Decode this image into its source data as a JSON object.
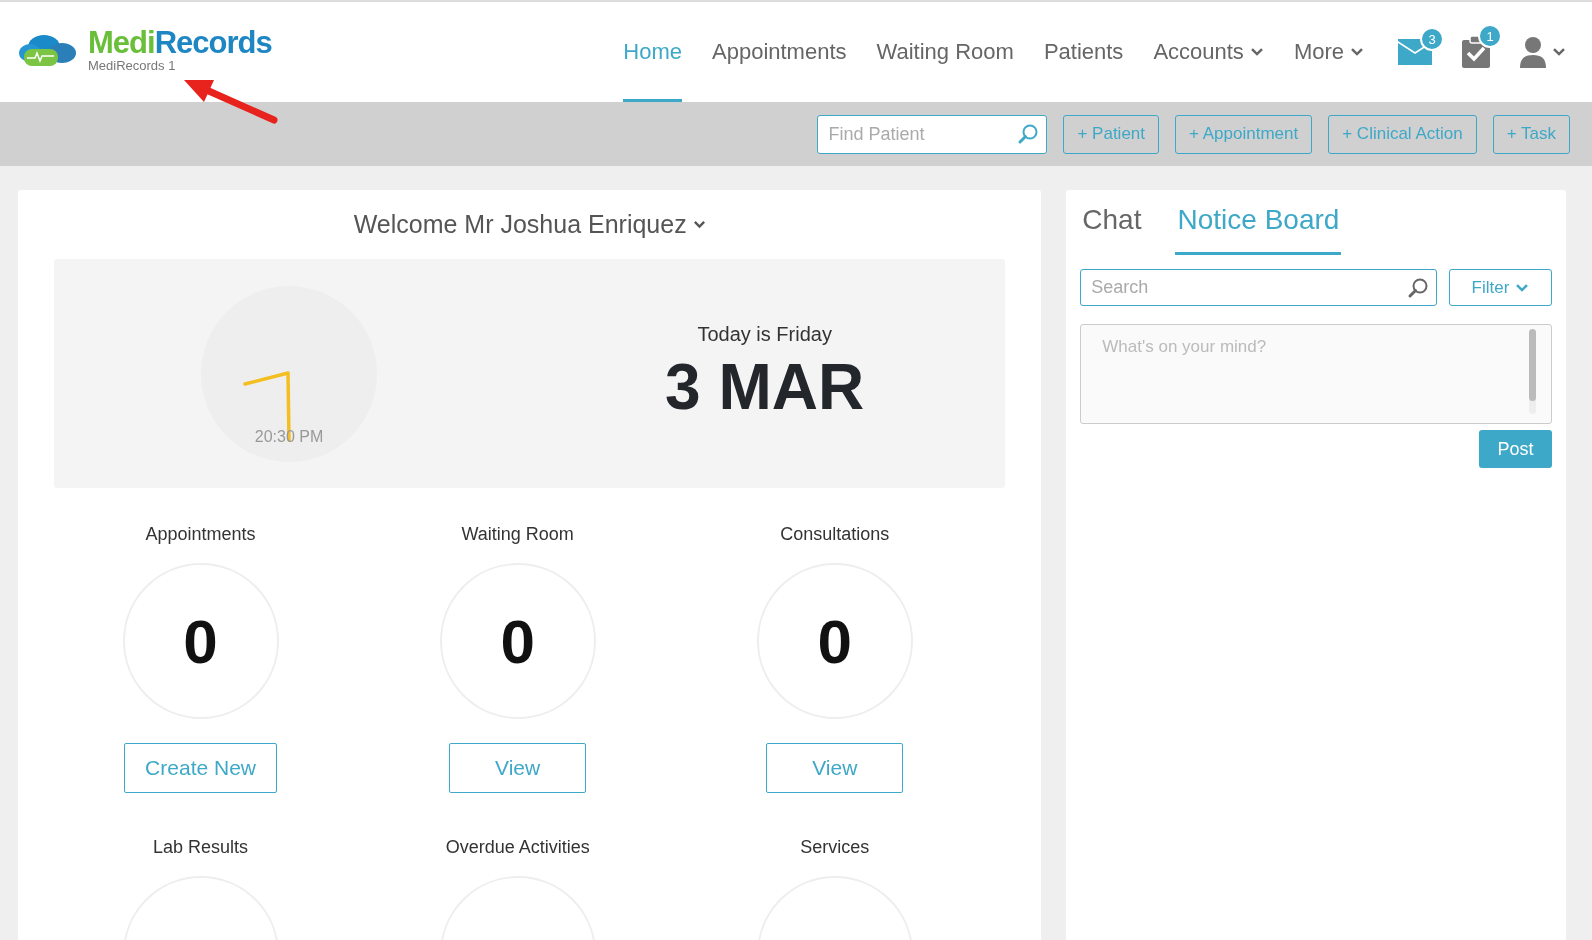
{
  "logo": {
    "name": [
      {
        "text": "Medi",
        "color": "#6abf3a"
      },
      {
        "text": "Records",
        "color": "#1f86c4"
      }
    ],
    "subtitle": "MediRecords 1"
  },
  "nav": [
    {
      "label": "Home",
      "selected": true,
      "dropdown": false
    },
    {
      "label": "Appointments",
      "selected": false,
      "dropdown": false
    },
    {
      "label": "Waiting Room",
      "selected": false,
      "dropdown": false
    },
    {
      "label": "Patients",
      "selected": false,
      "dropdown": false
    },
    {
      "label": "Accounts",
      "selected": false,
      "dropdown": true
    },
    {
      "label": "More",
      "selected": false,
      "dropdown": true
    }
  ],
  "notifications": [
    {
      "kind": "mail",
      "count": "3"
    },
    {
      "kind": "tasks",
      "count": "1"
    }
  ],
  "toolbar": {
    "search": {
      "placeholder": "Find Patient"
    },
    "buttons": [
      "+ Patient",
      "+ Appointment",
      "+ Clinical Action",
      "+ Task"
    ]
  },
  "welcome": {
    "title": "Welcome Mr Joshua Enriquez"
  },
  "clock": {
    "time": "20:30 PM"
  },
  "date": {
    "weekday_line": "Today is Friday",
    "date": "3 MAR"
  },
  "stats": [
    {
      "label": "Appointments",
      "count": "0",
      "action": "Create New"
    },
    {
      "label": "Waiting Room",
      "count": "0",
      "action": "View"
    },
    {
      "label": "Consultations",
      "count": "0",
      "action": "View"
    },
    {
      "label": "Lab Results"
    },
    {
      "label": "Overdue Activities"
    },
    {
      "label": "Services"
    }
  ],
  "side_tabs": [
    {
      "label": "Chat",
      "selected": false
    },
    {
      "label": "Notice Board",
      "selected": true
    }
  ],
  "notice": {
    "search": {
      "placeholder": "Search"
    },
    "filter": "Filter",
    "post": {
      "placeholder": "What's on your mind?",
      "button": "Post"
    }
  }
}
